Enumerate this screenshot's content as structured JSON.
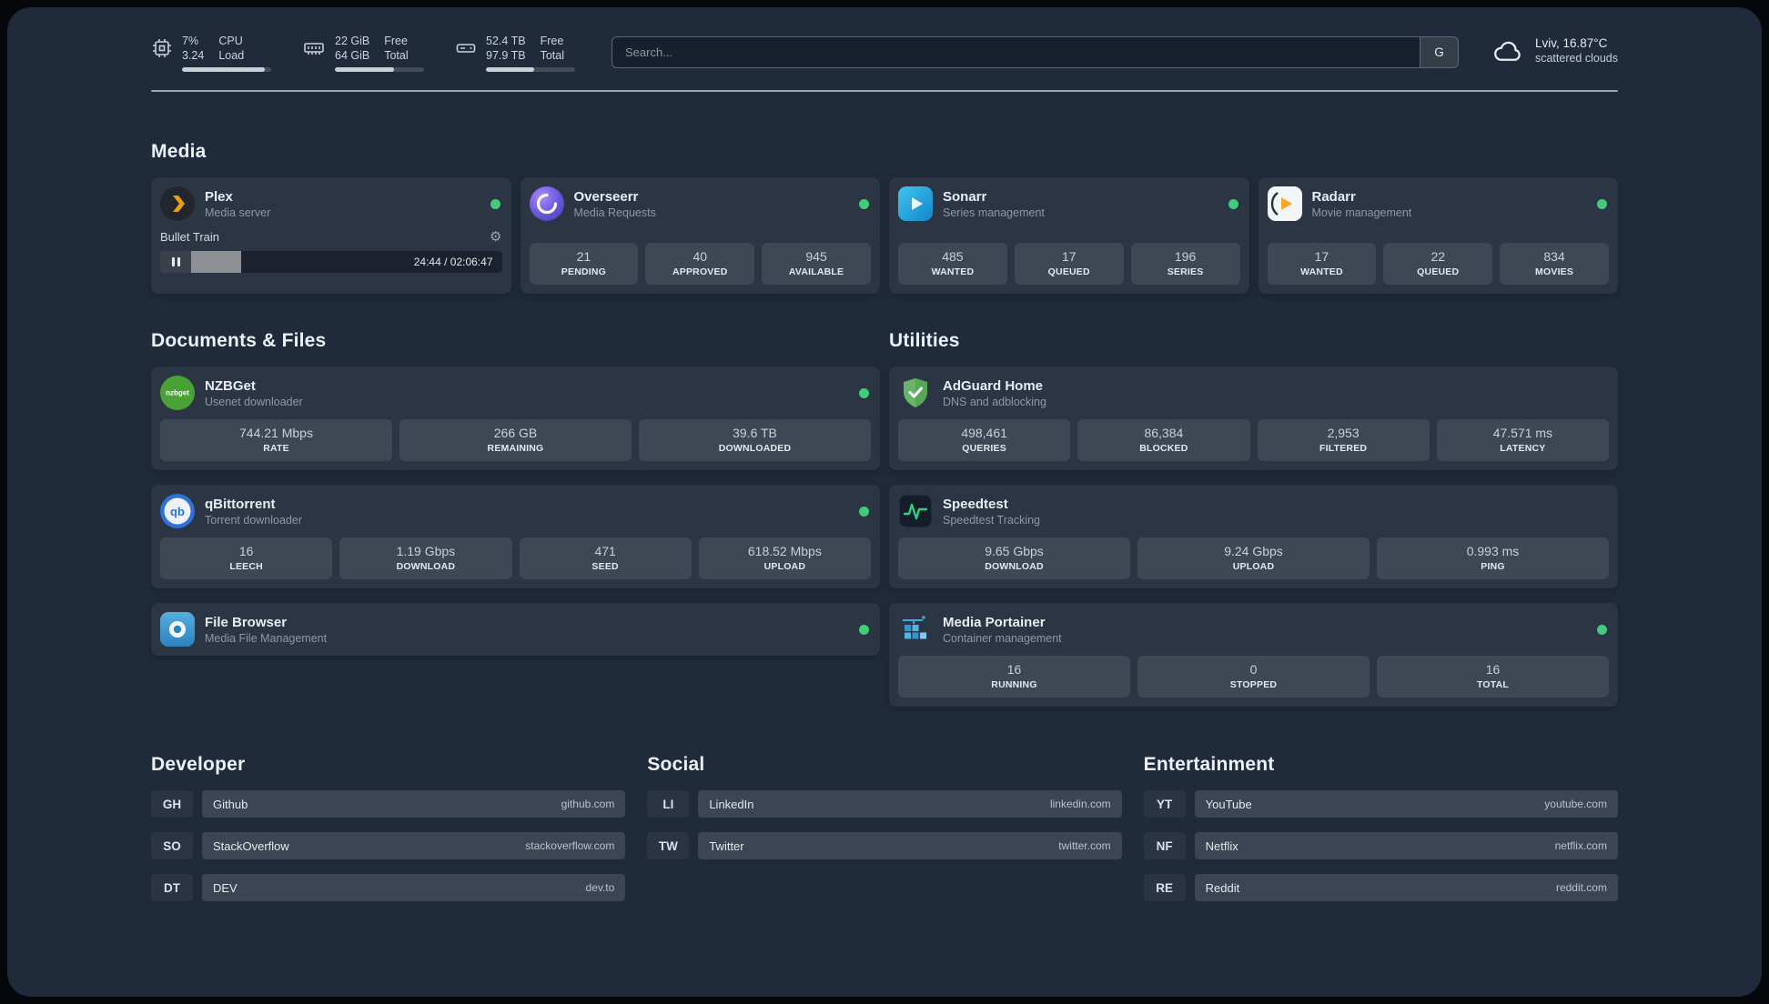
{
  "icons": {
    "gear": "⚙"
  },
  "topbar": {
    "cpu": {
      "value_top": "7%",
      "value_bottom": "3.24",
      "label_top": "CPU",
      "label_bottom": "Load",
      "bar_percent": 93
    },
    "memory": {
      "value_top": "22 GiB",
      "value_bottom": "64 GiB",
      "label_top": "Free",
      "label_bottom": "Total",
      "bar_percent": 66
    },
    "disk": {
      "value_top": "52.4 TB",
      "value_bottom": "97.9 TB",
      "label_top": "Free",
      "label_bottom": "Total",
      "bar_percent": 54
    },
    "search": {
      "placeholder": "Search...",
      "provider_label": "G"
    },
    "weather": {
      "location": "Lviv, 16.87°C",
      "condition": "scattered clouds"
    }
  },
  "sections": {
    "media": {
      "title": "Media",
      "plex": {
        "name": "Plex",
        "subtitle": "Media server",
        "now_playing": "Bullet Train",
        "time": "24:44 / 02:06:47",
        "progress_percent": 16
      },
      "overseerr": {
        "name": "Overseerr",
        "subtitle": "Media Requests",
        "stats": [
          {
            "value": "21",
            "label": "PENDING"
          },
          {
            "value": "40",
            "label": "APPROVED"
          },
          {
            "value": "945",
            "label": "AVAILABLE"
          }
        ]
      },
      "sonarr": {
        "name": "Sonarr",
        "subtitle": "Series management",
        "stats": [
          {
            "value": "485",
            "label": "WANTED"
          },
          {
            "value": "17",
            "label": "QUEUED"
          },
          {
            "value": "196",
            "label": "SERIES"
          }
        ]
      },
      "radarr": {
        "name": "Radarr",
        "subtitle": "Movie management",
        "stats": [
          {
            "value": "17",
            "label": "WANTED"
          },
          {
            "value": "22",
            "label": "QUEUED"
          },
          {
            "value": "834",
            "label": "MOVIES"
          }
        ]
      }
    },
    "documents": {
      "title": "Documents & Files",
      "nzbget": {
        "name": "NZBGet",
        "subtitle": "Usenet downloader",
        "icon_text": "nzbget",
        "stats": [
          {
            "value": "744.21 Mbps",
            "label": "RATE"
          },
          {
            "value": "266 GB",
            "label": "REMAINING"
          },
          {
            "value": "39.6 TB",
            "label": "DOWNLOADED"
          }
        ]
      },
      "qbittorrent": {
        "name": "qBittorrent",
        "subtitle": "Torrent downloader",
        "icon_text": "qb",
        "stats": [
          {
            "value": "16",
            "label": "LEECH"
          },
          {
            "value": "1.19 Gbps",
            "label": "DOWNLOAD"
          },
          {
            "value": "471",
            "label": "SEED"
          },
          {
            "value": "618.52 Mbps",
            "label": "UPLOAD"
          }
        ]
      },
      "filebrowser": {
        "name": "File Browser",
        "subtitle": "Media File Management"
      }
    },
    "utilities": {
      "title": "Utilities",
      "adguard": {
        "name": "AdGuard Home",
        "subtitle": "DNS and adblocking",
        "stats": [
          {
            "value": "498,461",
            "label": "QUERIES"
          },
          {
            "value": "86,384",
            "label": "BLOCKED"
          },
          {
            "value": "2,953",
            "label": "FILTERED"
          },
          {
            "value": "47.571 ms",
            "label": "LATENCY"
          }
        ]
      },
      "speedtest": {
        "name": "Speedtest",
        "subtitle": "Speedtest Tracking",
        "stats": [
          {
            "value": "9.65 Gbps",
            "label": "DOWNLOAD"
          },
          {
            "value": "9.24 Gbps",
            "label": "UPLOAD"
          },
          {
            "value": "0.993 ms",
            "label": "PING"
          }
        ]
      },
      "portainer": {
        "name": "Media Portainer",
        "subtitle": "Container management",
        "stats": [
          {
            "value": "16",
            "label": "RUNNING"
          },
          {
            "value": "0",
            "label": "STOPPED"
          },
          {
            "value": "16",
            "label": "TOTAL"
          }
        ]
      }
    },
    "bookmarks": [
      {
        "title": "Developer",
        "items": [
          {
            "abbr": "GH",
            "name": "Github",
            "url": "github.com"
          },
          {
            "abbr": "SO",
            "name": "StackOverflow",
            "url": "stackoverflow.com"
          },
          {
            "abbr": "DT",
            "name": "DEV",
            "url": "dev.to"
          }
        ]
      },
      {
        "title": "Social",
        "items": [
          {
            "abbr": "LI",
            "name": "LinkedIn",
            "url": "linkedin.com"
          },
          {
            "abbr": "TW",
            "name": "Twitter",
            "url": "twitter.com"
          }
        ]
      },
      {
        "title": "Entertainment",
        "items": [
          {
            "abbr": "YT",
            "name": "YouTube",
            "url": "youtube.com"
          },
          {
            "abbr": "NF",
            "name": "Netflix",
            "url": "netflix.com"
          },
          {
            "abbr": "RE",
            "name": "Reddit",
            "url": "reddit.com"
          }
        ]
      }
    ]
  }
}
